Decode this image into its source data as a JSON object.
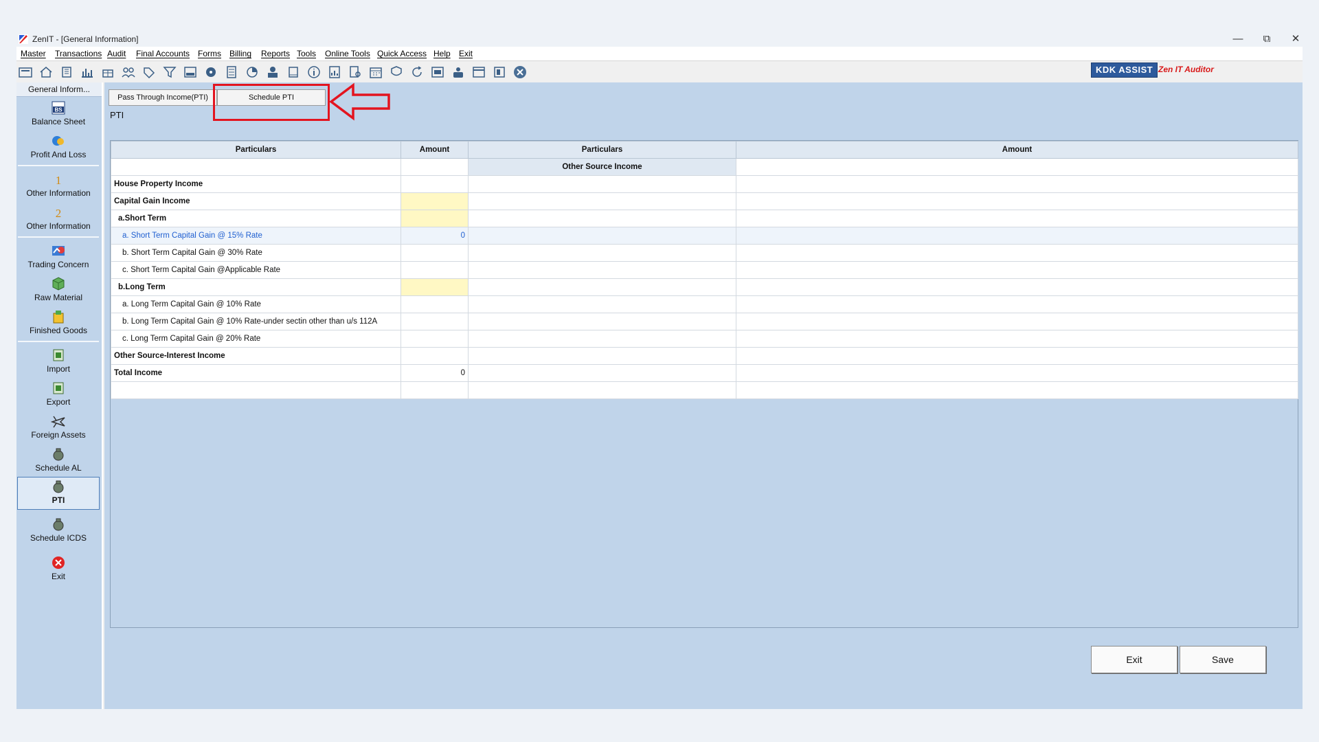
{
  "window": {
    "title": "ZenIT - [General Information]"
  },
  "menu": [
    "Master",
    "Transactions",
    "Audit",
    "Final Accounts",
    "Forms",
    "Billing",
    "Reports",
    "Tools",
    "Online Tools",
    "Quick Access",
    "Help",
    "Exit"
  ],
  "toolbar": {
    "icons": [
      "open-folder-icon",
      "home-icon",
      "building-icon",
      "bar-chart-icon",
      "gift-icon",
      "users-icon",
      "tag-icon",
      "funnel-icon",
      "tax-icon",
      "disc-icon",
      "calculator-icon",
      "pie-icon",
      "pay-icon",
      "book-icon",
      "info-icon",
      "report-icon",
      "document-search-icon",
      "calendar-icon",
      "shield-icon",
      "refresh-icon",
      "bs-icon",
      "people-icon",
      "cd-icon",
      "ledger-icon",
      "close-circle-icon"
    ],
    "kdk_label": "KDK ASSIST",
    "zen_label": "Zen IT Auditor"
  },
  "sidebar": {
    "header": "General Inform...",
    "items": [
      {
        "label": "Balance Sheet"
      },
      {
        "label": "Profit And Loss"
      },
      {
        "label": "Other Information"
      },
      {
        "label": "Other Information"
      },
      {
        "label": "Trading Concern"
      },
      {
        "label": "Raw Material"
      },
      {
        "label": "Finished Goods"
      },
      {
        "label": "Import"
      },
      {
        "label": "Export"
      },
      {
        "label": "Foreign Assets"
      },
      {
        "label": "Schedule AL"
      },
      {
        "label": "PTI"
      },
      {
        "label": "Schedule ICDS"
      },
      {
        "label": "Exit"
      }
    ],
    "badges": {
      "bs": "BS",
      "one": "1",
      "two": "2"
    }
  },
  "tabs": [
    {
      "label": "Pass Through Income(PTI)"
    },
    {
      "label": "Schedule PTI"
    }
  ],
  "section_label": "PTI",
  "grid": {
    "headers": [
      "Particulars",
      "Amount",
      "Particulars",
      "Amount"
    ],
    "subheader": "Other Source Income",
    "rows": [
      {
        "label": "House Property Income",
        "amount": ""
      },
      {
        "label": "Capital Gain Income",
        "amount": ""
      },
      {
        "label": "a.Short Term",
        "amount": ""
      },
      {
        "label": "a. Short Term Capital Gain @ 15% Rate",
        "amount": "0"
      },
      {
        "label": "b. Short Term Capital Gain @ 30% Rate",
        "amount": ""
      },
      {
        "label": "c. Short Term Capital Gain @Applicable Rate",
        "amount": ""
      },
      {
        "label": "b.Long Term",
        "amount": ""
      },
      {
        "label": "a. Long Term Capital Gain @ 10% Rate",
        "amount": ""
      },
      {
        "label": "b. Long Term Capital Gain @ 10% Rate-under sectin other than u/s 112A",
        "amount": ""
      },
      {
        "label": "c. Long Term Capital Gain @ 20% Rate",
        "amount": ""
      },
      {
        "label": "Other Source-Interest Income",
        "amount": ""
      },
      {
        "label": "Total Income",
        "amount": "0"
      },
      {
        "label": "",
        "amount": ""
      }
    ]
  },
  "buttons": {
    "exit": "Exit",
    "save": "Save"
  }
}
